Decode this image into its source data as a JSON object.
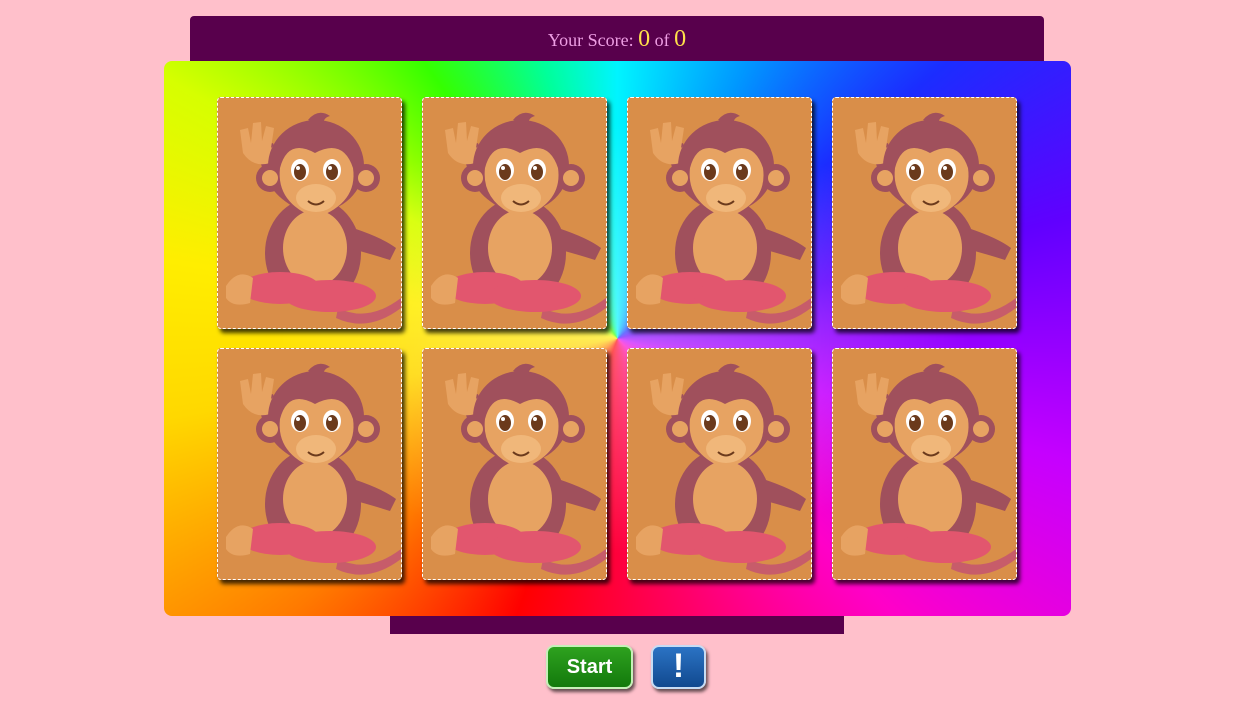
{
  "score": {
    "label": "Your Score:",
    "value": "0",
    "separator": "of",
    "total": "0"
  },
  "cards": [
    {
      "state": "face-down",
      "icon": "monkey-icon"
    },
    {
      "state": "face-down",
      "icon": "monkey-icon"
    },
    {
      "state": "face-down",
      "icon": "monkey-icon"
    },
    {
      "state": "face-down",
      "icon": "monkey-icon"
    },
    {
      "state": "face-down",
      "icon": "monkey-icon"
    },
    {
      "state": "face-down",
      "icon": "monkey-icon"
    },
    {
      "state": "face-down",
      "icon": "monkey-icon"
    },
    {
      "state": "face-down",
      "icon": "monkey-icon"
    }
  ],
  "controls": {
    "start_label": "Start",
    "info_label": "!"
  },
  "colors": {
    "page_background": "#ffc0cb",
    "bar_color": "#58004c",
    "score_label_color": "#ee9ee4",
    "score_value_color": "#ffe14a",
    "card_back": "#d98e49",
    "start_button": "#1e8f14",
    "info_button": "#1a5aa8"
  }
}
